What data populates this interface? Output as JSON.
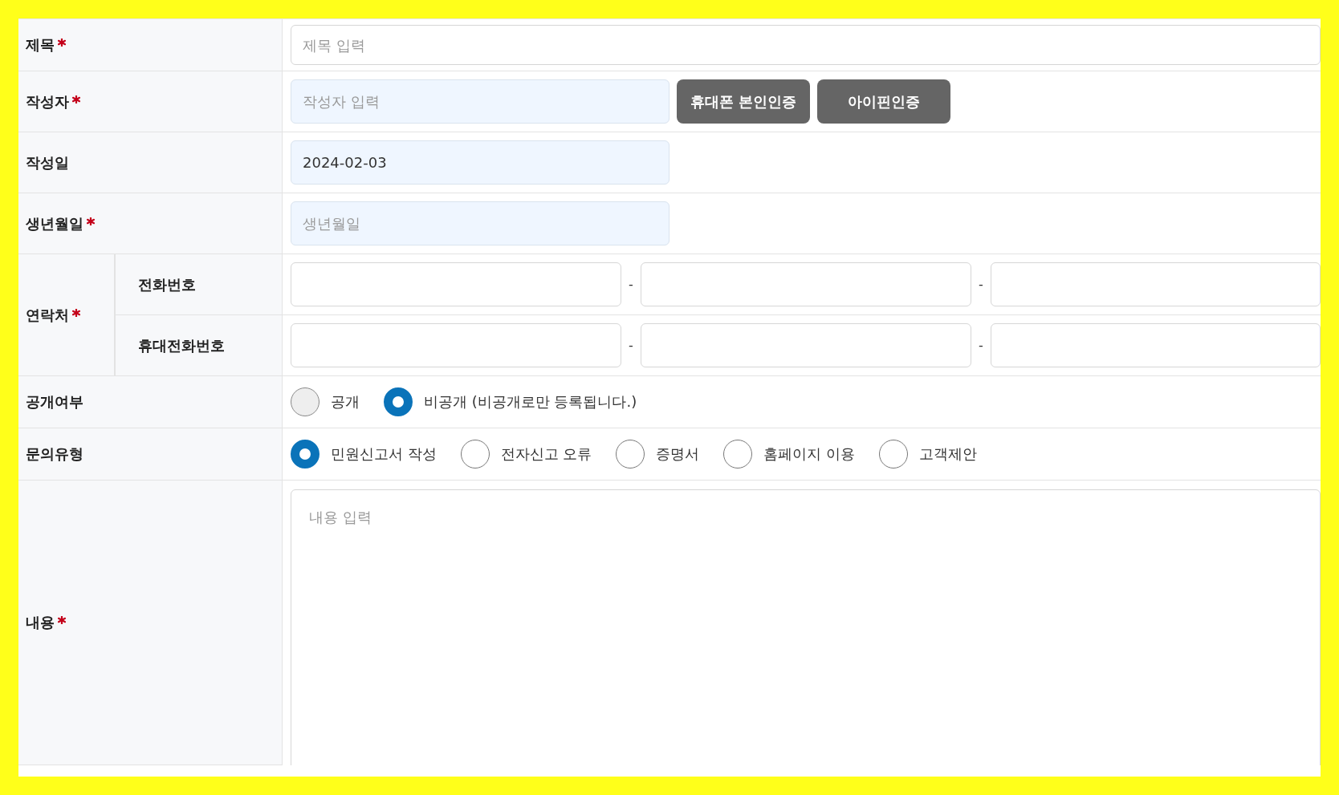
{
  "rows": [
    {
      "kind": "text",
      "label": "제목",
      "required": true,
      "readonly": false,
      "placeholder": "제목 입력",
      "wide": true
    },
    {
      "kind": "text",
      "label": "작성자",
      "required": true,
      "readonly": true,
      "placeholder": "작성자 입력",
      "wide": false,
      "buttons": [
        "휴대폰 본인인증",
        "아이핀인증"
      ]
    },
    {
      "kind": "text",
      "label": "작성일",
      "required": false,
      "readonly": true,
      "value": "2024-02-03",
      "wide": false
    },
    {
      "kind": "text",
      "label": "생년월일",
      "required": true,
      "readonly": true,
      "placeholder": "생년월일",
      "wide": false
    },
    {
      "kind": "contact",
      "label": "연락처",
      "required": true,
      "lines": [
        {
          "label": "전화번호",
          "separators": [
            "-",
            "-"
          ]
        },
        {
          "label": "휴대전화번호",
          "separators": [
            "-",
            "-"
          ]
        }
      ]
    },
    {
      "kind": "radio",
      "label": "공개여부",
      "required": false,
      "options": [
        {
          "label": "공개",
          "selected": false,
          "disabled": true
        },
        {
          "label": "비공개 (비공개로만 등록됩니다.)",
          "selected": true,
          "disabled": false
        }
      ]
    },
    {
      "kind": "radio",
      "label": "문의유형",
      "required": false,
      "options": [
        {
          "label": "민원신고서 작성",
          "selected": true,
          "disabled": false
        },
        {
          "label": "전자신고 오류",
          "selected": false,
          "disabled": false
        },
        {
          "label": "증명서",
          "selected": false,
          "disabled": false
        },
        {
          "label": "홈페이지 이용",
          "selected": false,
          "disabled": false
        },
        {
          "label": "고객제안",
          "selected": false,
          "disabled": false
        }
      ]
    },
    {
      "kind": "textarea",
      "label": "내용",
      "required": true,
      "placeholder": "내용 입력"
    }
  ]
}
